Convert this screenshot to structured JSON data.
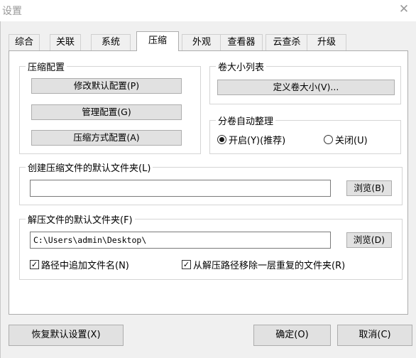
{
  "window": {
    "title": "设置",
    "close_glyph": "✕"
  },
  "tabs": [
    {
      "label": "综合"
    },
    {
      "label": "关联"
    },
    {
      "label": "系统"
    },
    {
      "label": "压缩"
    },
    {
      "label": "外观"
    },
    {
      "label": "查看器"
    },
    {
      "label": "云查杀"
    },
    {
      "label": "升级"
    }
  ],
  "compress_config": {
    "legend": "压缩配置",
    "modify_default": "修改默认配置(P)",
    "manage": "管理配置(G)",
    "method": "压缩方式配置(A)"
  },
  "volume_list": {
    "legend": "卷大小列表",
    "define": "定义卷大小(V)..."
  },
  "volume_auto": {
    "legend": "分卷自动整理",
    "on_label": "开启(Y)(推荐)",
    "off_label": "关闭(U)",
    "selected": "on"
  },
  "default_folder": {
    "legend": "创建压缩文件的默认文件夹(L)",
    "value": "",
    "browse": "浏览(B)"
  },
  "extract_folder": {
    "legend": "解压文件的默认文件夹(F)",
    "value": "C:\\Users\\admin\\Desktop\\",
    "browse": "浏览(D)",
    "append_name": "路径中追加文件名(N)",
    "remove_dup": "从解压路径移除一层重复的文件夹(R)",
    "append_checked": true,
    "remove_checked": true
  },
  "footer": {
    "restore": "恢复默认设置(X)",
    "ok": "确定(O)",
    "cancel": "取消(C)"
  }
}
